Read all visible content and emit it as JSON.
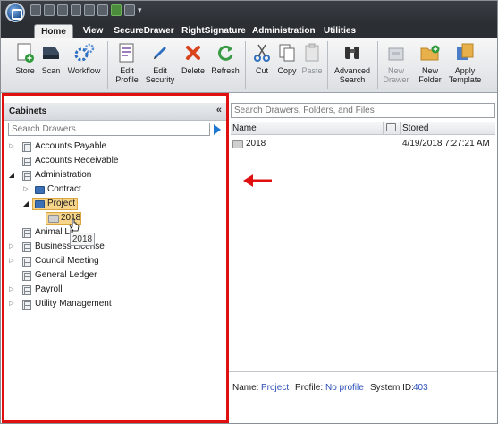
{
  "ribbon_tabs": [
    {
      "label": "Home",
      "active": true
    },
    {
      "label": "View"
    },
    {
      "label": "SecureDrawer"
    },
    {
      "label": "RightSignature"
    },
    {
      "label": "Administration"
    },
    {
      "label": "Utilities"
    }
  ],
  "ribbon_buttons": [
    {
      "label": "Store",
      "icon": "store-document-icon"
    },
    {
      "label": "Scan",
      "icon": "scanner-icon"
    },
    {
      "label": "Workflow",
      "icon": "workflow-gears-icon"
    },
    {
      "label": "Edit Profile",
      "icon": "edit-profile-icon"
    },
    {
      "label": "Edit Security",
      "icon": "pencil-icon"
    },
    {
      "label": "Delete",
      "icon": "red-x-icon"
    },
    {
      "label": "Refresh",
      "icon": "refresh-icon"
    },
    {
      "label": "Cut",
      "icon": "scissors-icon"
    },
    {
      "label": "Copy",
      "icon": "copy-icon"
    },
    {
      "label": "Paste",
      "icon": "paste-icon",
      "disabled": true
    },
    {
      "label": "Advanced Search",
      "icon": "binoculars-icon"
    },
    {
      "label": "New Drawer",
      "icon": "new-drawer-icon",
      "disabled": true
    },
    {
      "label": "New Folder",
      "icon": "new-folder-icon"
    },
    {
      "label": "Apply Template",
      "icon": "apply-template-icon"
    }
  ],
  "cabinets": {
    "title": "Cabinets",
    "collapse_glyph": "«",
    "search_placeholder": "Search Drawers",
    "tree": {
      "accounts_payable": "Accounts Payable",
      "accounts_receivable": "Accounts Receivable",
      "administration": "Administration",
      "contract": "Contract",
      "project": "Project",
      "folder_2018": "2018",
      "animal_lic": "Animal Lic",
      "business_license": "Business License",
      "council_meeting": "Council Meeting",
      "general_ledger": "General Ledger",
      "payroll": "Payroll",
      "utility_management": "Utility Management"
    },
    "tooltip": "2018"
  },
  "content": {
    "search_placeholder": "Search Drawers, Folders, and Files",
    "col_name": "Name",
    "col_stored": "Stored",
    "rows": [
      {
        "name": "2018",
        "stored": "4/19/2018 7:27:21 AM"
      }
    ]
  },
  "status": {
    "name_label": "Name:",
    "name_value": "Project",
    "profile_label": "Profile:",
    "profile_value": "No profile",
    "sysid_label": "System ID:",
    "sysid_value": "403"
  },
  "colors": {
    "highlight_frame": "#e01010",
    "selection": "#f6d58a",
    "link_blue": "#2b4fb8",
    "ribbon_dark": "#2b2e33"
  }
}
